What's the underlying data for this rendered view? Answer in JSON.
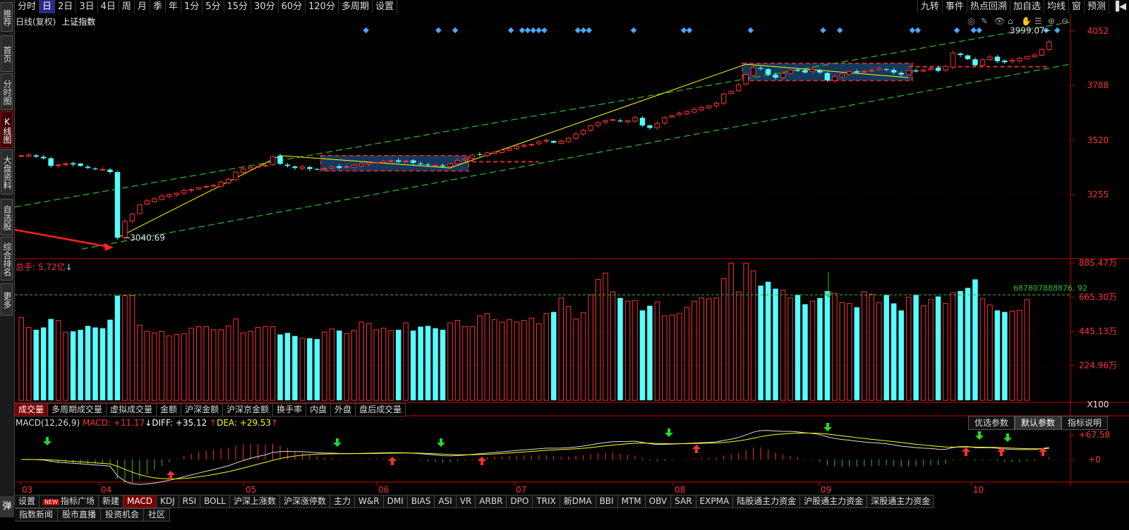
{
  "left_tabs": [
    "推荐",
    "首页",
    "分时图",
    "K线图",
    "大盘资料",
    "自选股",
    "综合排名",
    "更多"
  ],
  "left_active": 3,
  "periods": [
    "分时",
    "日",
    "2日",
    "3日",
    "4日",
    "周",
    "月",
    "季",
    "年",
    "1分",
    "5分",
    "15分",
    "30分",
    "60分",
    "120分",
    "多周期",
    "设置"
  ],
  "period_active": 1,
  "right_tools": [
    "九转",
    "事件",
    "热点回溯",
    "加自选",
    "均线",
    "窗",
    "预测"
  ],
  "chart_header": {
    "kind": "日线(复权)",
    "name": "上证指数"
  },
  "price_axis": [
    "4052",
    "3788",
    "3520",
    "3255"
  ],
  "low_label": "3040.69",
  "high_label": "3999.07",
  "volume_header": "总手: 5.72亿",
  "volume_axis": [
    "885.47万",
    "665.30万",
    "445.13万",
    "224.96万",
    "X100"
  ],
  "volume_ma_label": "687807888876. 92",
  "volume_tabs": [
    "成交量",
    "多周期成交量",
    "虚拟成交量",
    "金额",
    "沪深金额",
    "沪深京金额",
    "换手率",
    "内盘",
    "外盘",
    "盘后成交量"
  ],
  "macd_header": {
    "name": "MACD(12,26,9)",
    "macd": "MACD: +11.17",
    "diff": "DIFF: +35.12",
    "dea": "DEA: +29.53"
  },
  "macd_axis": [
    "+67.58",
    "+0"
  ],
  "macd_buttons": [
    "优选参数",
    "默认参数",
    "指标说明"
  ],
  "months": [
    "03",
    "04",
    "05",
    "06",
    "07",
    "08",
    "09",
    "10"
  ],
  "indicator_tabs": [
    "设置",
    "指标广场",
    "新建",
    "MACD",
    "KDJ",
    "RSI",
    "BOLL",
    "沪深上涨数",
    "沪深涨停数",
    "主力",
    "W&R",
    "DMI",
    "BIAS",
    "ASI",
    "VR",
    "ARBR",
    "DPO",
    "TRIX",
    "新DMA",
    "BBI",
    "MTM",
    "OBV",
    "SAR",
    "EXPMA",
    "陆股通主力资金",
    "沪股通主力资金",
    "深股通主力资金"
  ],
  "bottom_tabs": [
    "指数新闻",
    "股市直播",
    "投资机会",
    "社区"
  ],
  "speech_label": "弹",
  "colors": {
    "up": "#ff3232",
    "down": "#54ffff",
    "ma": "#ffff00",
    "trend": "#2bbf2b",
    "axis": "#cc0000"
  },
  "chart_data": {
    "type": "candlestick",
    "title": "上证指数",
    "ylim": [
      2950,
      4100
    ],
    "closes": [
      3445,
      3448,
      3440,
      3432,
      3395,
      3400,
      3405,
      3402,
      3395,
      3385,
      3380,
      3378,
      3365,
      3045,
      3125,
      3160,
      3205,
      3225,
      3235,
      3248,
      3255,
      3262,
      3275,
      3280,
      3290,
      3295,
      3300,
      3315,
      3330,
      3365,
      3380,
      3388,
      3392,
      3398,
      3440,
      3405,
      3395,
      3385,
      3390,
      3380,
      3378,
      3382,
      3390,
      3385,
      3392,
      3398,
      3405,
      3410,
      3412,
      3418,
      3420,
      3415,
      3418,
      3410,
      3405,
      3400,
      3398,
      3392,
      3405,
      3422,
      3430,
      3448,
      3450,
      3458,
      3462,
      3472,
      3480,
      3490,
      3496,
      3500,
      3512,
      3520,
      3508,
      3515,
      3530,
      3550,
      3568,
      3590,
      3605,
      3615,
      3620,
      3612,
      3615,
      3630,
      3592,
      3580,
      3602,
      3630,
      3640,
      3652,
      3660,
      3670,
      3680,
      3688,
      3700,
      3745,
      3758,
      3790,
      3840,
      3875,
      3868,
      3840,
      3825,
      3845,
      3860,
      3858,
      3850,
      3865,
      3850,
      3812,
      3830,
      3842,
      3855,
      3850,
      3855,
      3860,
      3870,
      3865,
      3850,
      3840,
      3860,
      3855,
      3862,
      3870,
      3858,
      3880,
      3945,
      3935,
      3915,
      3885,
      3912,
      3925,
      3905,
      3900,
      3910,
      3920,
      3928,
      3935,
      3962,
      3999
    ],
    "volumes": [
      535,
      470,
      455,
      470,
      525,
      515,
      440,
      445,
      455,
      480,
      470,
      465,
      520,
      675,
      675,
      675,
      485,
      445,
      435,
      445,
      415,
      425,
      430,
      465,
      475,
      475,
      455,
      455,
      480,
      525,
      435,
      445,
      470,
      475,
      475,
      425,
      435,
      415,
      400,
      400,
      395,
      440,
      460,
      450,
      430,
      450,
      505,
      495,
      455,
      465,
      450,
      455,
      500,
      450,
      475,
      480,
      465,
      455,
      500,
      515,
      475,
      475,
      545,
      560,
      520,
      505,
      520,
      505,
      515,
      530,
      495,
      560,
      570,
      660,
      605,
      525,
      565,
      680,
      780,
      820,
      700,
      660,
      640,
      645,
      580,
      610,
      635,
      545,
      550,
      560,
      600,
      640,
      660,
      655,
      660,
      785,
      885,
      700,
      885,
      835,
      740,
      765,
      720,
      710,
      660,
      680,
      620,
      640,
      660,
      705,
      690,
      630,
      625,
      600,
      700,
      685,
      630,
      680,
      625,
      580,
      665,
      680,
      610,
      650,
      670,
      625,
      695,
      705,
      725,
      780,
      655,
      615,
      580,
      570,
      575,
      580,
      650
    ]
  }
}
